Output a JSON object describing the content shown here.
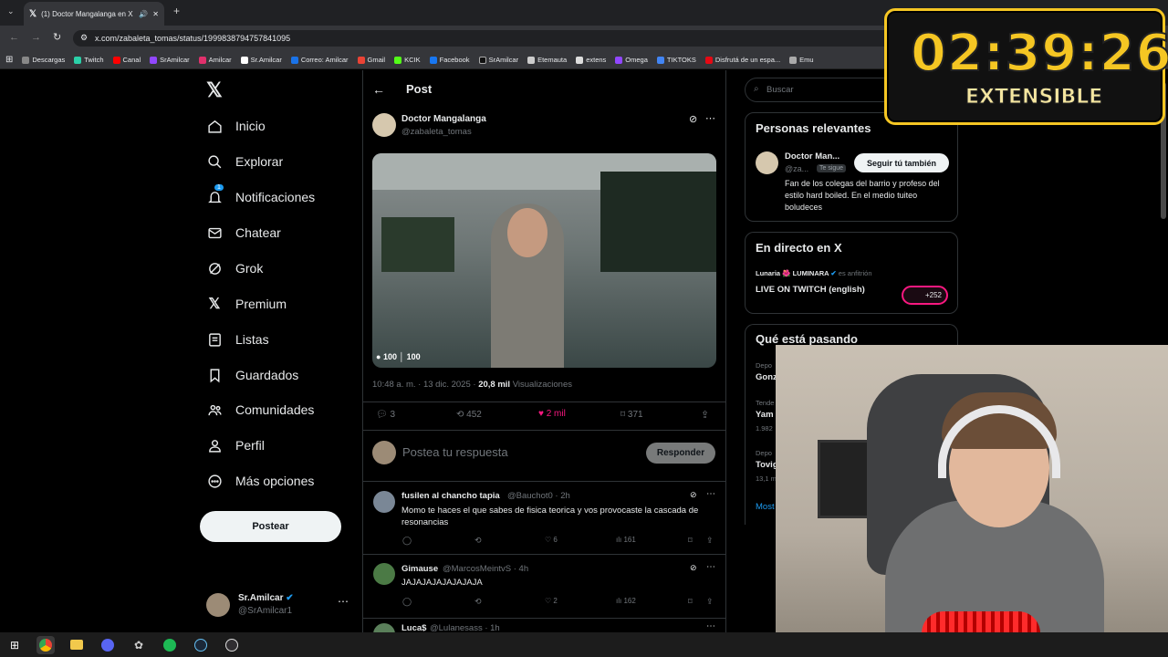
{
  "browser": {
    "tab_title": "(1) Doctor Mangalanga en X",
    "url": "x.com/zabaleta_tomas/status/1999838794757841095",
    "bookmarks": [
      "Descargas",
      "Twitch",
      "Canal",
      "SrAmilcar",
      "Amilcar",
      "Sr.Amilcar",
      "Correo: Amilcar",
      "Gmail",
      "KCIK",
      "Facebook",
      "SrAmilcar",
      "Etemauta",
      "extens",
      "Omega",
      "TIKTOKS",
      "Disfrutá de un espa...",
      "Emu"
    ]
  },
  "sidebar": {
    "items": [
      {
        "label": "Inicio",
        "icon": "home-icon"
      },
      {
        "label": "Explorar",
        "icon": "search-icon"
      },
      {
        "label": "Notificaciones",
        "icon": "bell-icon",
        "badge": "1"
      },
      {
        "label": "Chatear",
        "icon": "mail-icon"
      },
      {
        "label": "Grok",
        "icon": "grok-icon"
      },
      {
        "label": "Premium",
        "icon": "x-logo-icon"
      },
      {
        "label": "Listas",
        "icon": "list-icon"
      },
      {
        "label": "Guardados",
        "icon": "bookmark-icon"
      },
      {
        "label": "Comunidades",
        "icon": "people-icon"
      },
      {
        "label": "Perfil",
        "icon": "person-icon"
      },
      {
        "label": "Más opciones",
        "icon": "more-circle-icon"
      }
    ],
    "post_button": "Postear",
    "account": {
      "name": "Sr.Amilcar",
      "handle": "@SrAmilcar1"
    }
  },
  "post": {
    "header": "Post",
    "author": "Doctor Mangalanga",
    "handle": "@zabaleta_tomas",
    "hud_left": "100",
    "hud_right": "100",
    "time": "10:48 a. m. · 13 dic. 2025 ·",
    "views": "20,8 mil",
    "views_label": "Visualizaciones",
    "replies": "3",
    "reposts": "452",
    "likes": "2 mil",
    "bookmarks": "371",
    "reply_placeholder": "Postea tu respuesta",
    "reply_button": "Responder"
  },
  "replies": [
    {
      "name": "fusilen al chancho tapia",
      "handle": "@Bauchot0 · 2h",
      "text": "Momo te haces el que sabes de fisica teorica y vos provocaste la cascada de resonancias",
      "likes": "6",
      "views": "161"
    },
    {
      "name": "Gimause",
      "handle": "@MarcosMeintvS · 4h",
      "text": "JAJAJAJAJAJAJAJA",
      "likes": "2",
      "views": "162"
    },
    {
      "name": "Luca$",
      "handle": "@Lulanesass · 1h",
      "text": "",
      "likes": "",
      "views": ""
    }
  ],
  "right": {
    "search_placeholder": "Buscar",
    "relevant_title": "Personas relevantes",
    "relevant_name": "Doctor Man...",
    "relevant_handle": "@za...",
    "follows_you": "Te sigue",
    "follow_button": "Seguir tú también",
    "relevant_bio": "Fan de los colegas del barrio y profeso del estilo hard boiled. En el medio tuiteo boludeces",
    "live_title": "En directo en X",
    "live_host": "Lunaria 🌺 LUMINARA",
    "live_host_role": "es anfitrión",
    "live_text": "LIVE ON TWITCH (english)",
    "live_count": "+252",
    "trending_title": "Qué está pasando",
    "trends": [
      {
        "cat": "Depo",
        "name": "Gonz"
      },
      {
        "cat": "Tende",
        "name": "Yam",
        "count": "1.982"
      },
      {
        "cat": "Depo",
        "name": "Tovig",
        "count": "13,1 m"
      }
    ],
    "show_more": "Most"
  },
  "overlay": {
    "timer": "02:39:26",
    "subtitle": "EXTENSIBLE"
  },
  "colors": {
    "accent": "#1d9bf0",
    "like": "#f91880",
    "timer": "#f5c623"
  }
}
